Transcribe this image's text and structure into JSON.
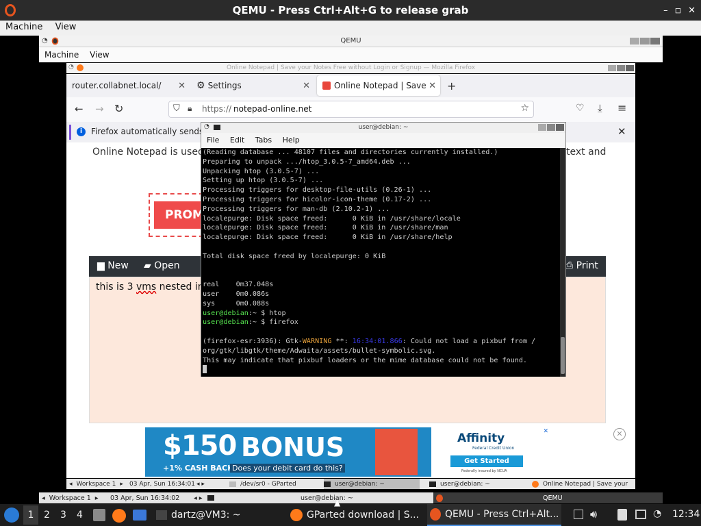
{
  "outer_qemu": {
    "title": "QEMU - Press Ctrl+Alt+G to release grab",
    "menu": [
      "Machine",
      "View"
    ],
    "win_buttons": [
      "–",
      "◽",
      "✕"
    ]
  },
  "inner_qemu": {
    "title": "QEMU",
    "menu": [
      "Machine",
      "View"
    ]
  },
  "firefox": {
    "window_title": "Online Notepad | Save your Notes Free without Login or Signup — Mozilla Firefox",
    "tabs": [
      {
        "label": "router.collabnet.local/"
      },
      {
        "label": "Settings"
      },
      {
        "label": "Online Notepad | Save yo"
      }
    ],
    "new_tab": "+",
    "url_prefix": "https://",
    "url_domain": "notepad-online.net",
    "notice": "Firefox automatically sends so",
    "page_text_left": "Online Notepad is used t",
    "page_text_right": "text and",
    "promo_text": "PROM",
    "toolbar": {
      "new": "New",
      "open": "Open",
      "print": "Print"
    },
    "editor_text_1": "this is 3 ",
    "editor_text_vms": "vms",
    "editor_text_2": " nested in g",
    "ad": {
      "amount": "$150",
      "bonus": "BONUS",
      "sub1": "+1% CASH BACK",
      "sub2": "Does your debit card do this?",
      "brand": "Affinity",
      "brand_sub": "Federal Credit Union",
      "cta": "Get Started",
      "fine": "Federally insured by NCUA"
    }
  },
  "terminal": {
    "title": "user@debian: ~",
    "menu": [
      "File",
      "Edit",
      "Tabs",
      "Help"
    ],
    "lines": [
      "(Reading database ... 48107 files and directories currently installed.)",
      "Preparing to unpack .../htop_3.0.5-7_amd64.deb ...",
      "Unpacking htop (3.0.5-7) ...",
      "Setting up htop (3.0.5-7) ...",
      "Processing triggers for desktop-file-utils (0.26-1) ...",
      "Processing triggers for hicolor-icon-theme (0.17-2) ...",
      "Processing triggers for man-db (2.10.2-1) ...",
      "localepurge: Disk space freed:      0 KiB in /usr/share/locale",
      "localepurge: Disk space freed:      0 KiB in /usr/share/man",
      "localepurge: Disk space freed:      0 KiB in /usr/share/help",
      "",
      "Total disk space freed by localepurge: 0 KiB",
      "",
      "",
      "real    0m37.048s",
      "user    0m0.086s",
      "sys     0m0.088s"
    ],
    "prompt": "user@debian",
    "cmd1": ":~ $ htop",
    "cmd2": ":~ $ firefox",
    "warn_pre": "(firefox-esr:3936): Gtk-",
    "warn_word": "WARNING",
    "warn_mid": " **: ",
    "warn_time": "16:34:01.866",
    "warn_post": ": Could not load a pixbuf from /",
    "warn_line2": "org/gtk/libgtk/theme/Adwaita/assets/bullet-symbolic.svg.",
    "warn_line3": "This may indicate that pixbuf loaders or the mime database could not be found."
  },
  "vm3_taskbar": {
    "workspace": "Workspace 1",
    "clock": "03 Apr, Sun 16:34:01",
    "items": [
      "/dev/sr0 - GParted",
      "user@debian: ~",
      "user@debian: ~",
      "Online Notepad | Save your"
    ]
  },
  "vm2_taskbar": {
    "workspace": "Workspace 1",
    "clock": "03 Apr, Sun 16:34:02",
    "items": [
      "user@debian: ~",
      "QEMU"
    ]
  },
  "host_taskbar": {
    "workspaces": [
      "1",
      "2",
      "3",
      "4"
    ],
    "active_workspace": "1",
    "items": [
      "dartz@VM3: ~",
      "GParted download | S...",
      "QEMU - Press Ctrl+Alt..."
    ],
    "time": "12:34"
  }
}
